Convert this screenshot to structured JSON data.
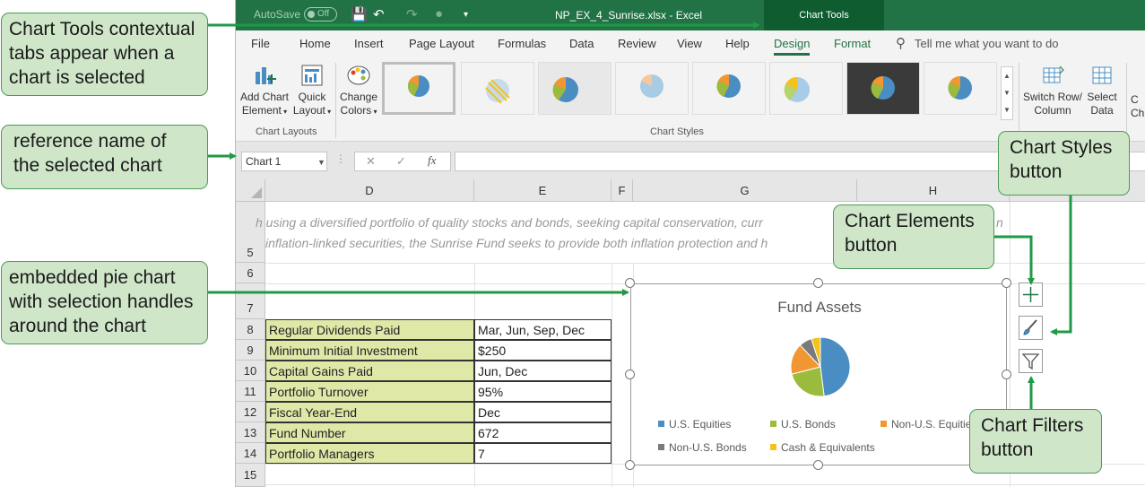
{
  "titlebar": {
    "autosave": "AutoSave",
    "autosave_state": "Off",
    "filename": "NP_EX_4_Sunrise.xlsx  -  Excel",
    "contextual_group": "Chart Tools"
  },
  "tabs": [
    "File",
    "Home",
    "Insert",
    "Page Layout",
    "Formulas",
    "Data",
    "Review",
    "View",
    "Help",
    "Design",
    "Format"
  ],
  "active_tab": "Design",
  "tellme": "Tell me what you want to do",
  "ribbon": {
    "add_chart_element": [
      "Add Chart",
      "Element"
    ],
    "quick_layout": [
      "Quick",
      "Layout"
    ],
    "change_colors": [
      "Change",
      "Colors"
    ],
    "group_chart_layouts": "Chart Layouts",
    "group_chart_styles": "Chart Styles",
    "switch_row_column": [
      "Switch Row/",
      "Column"
    ],
    "select_data": [
      "Select",
      "Data"
    ],
    "cut_off": [
      "C",
      "Ch"
    ]
  },
  "formula_bar": {
    "name_box": "Chart 1",
    "cancel": "✕",
    "enter": "✓",
    "fx": "fx"
  },
  "columns": [
    "D",
    "E",
    "F",
    "G",
    "H"
  ],
  "rows": [
    "5",
    "6",
    "7",
    "8",
    "9",
    "10",
    "11",
    "12",
    "13",
    "14",
    "15"
  ],
  "description": [
    "h using a diversified portfolio of quality stocks and bonds, seeking capital conservation, curr",
    "inflation-linked securities, the Sunrise Fund seeks to provide both inflation protection and h"
  ],
  "description_tail": "n",
  "table": [
    {
      "label": "Regular Dividends Paid",
      "value": "Mar, Jun, Sep, Dec"
    },
    {
      "label": "Minimum Initial Investment",
      "value": "$250"
    },
    {
      "label": "Capital Gains Paid",
      "value": "Jun, Dec"
    },
    {
      "label": "Portfolio Turnover",
      "value": "95%"
    },
    {
      "label": "Fiscal Year-End",
      "value": "Dec"
    },
    {
      "label": "Fund Number",
      "value": "672"
    },
    {
      "label": "Portfolio Managers",
      "value": "7"
    }
  ],
  "chart_data": {
    "type": "pie",
    "title": "Fund Assets",
    "series": [
      {
        "name": "U.S. Equities",
        "value": 48,
        "color": "#4a8dc2"
      },
      {
        "name": "U.S. Bonds",
        "value": 23,
        "color": "#9bbb3c"
      },
      {
        "name": "Non-U.S. Equities",
        "value": 17,
        "color": "#f19731"
      },
      {
        "name": "Non-U.S. Bonds",
        "value": 7,
        "color": "#7a7a7a"
      },
      {
        "name": "Cash & Equivalents",
        "value": 5,
        "color": "#f4c21c"
      }
    ],
    "legend_labels": [
      "U.S. Equities",
      "U.S. Bonds",
      "Non-U.S. Equitie",
      "Non-U.S. Bonds",
      "Cash & Equivalents"
    ],
    "legend_position": "bottom"
  },
  "callouts": {
    "contextual": [
      "Chart Tools contextual",
      "tabs appear when a",
      "chart is selected"
    ],
    "reference": [
      "reference name of",
      "the selected chart"
    ],
    "embedded": [
      "embedded pie chart",
      "with selection handles",
      "around the chart"
    ],
    "styles": [
      "Chart Styles",
      "button"
    ],
    "elements": [
      "Chart Elements",
      "button"
    ],
    "filters": [
      "Chart Filters",
      "button"
    ]
  },
  "colors": {
    "excel_green": "#217346",
    "callout_fill": "#cfe6c9",
    "callout_border": "#4c9a58",
    "arrow": "#1f9a45"
  }
}
